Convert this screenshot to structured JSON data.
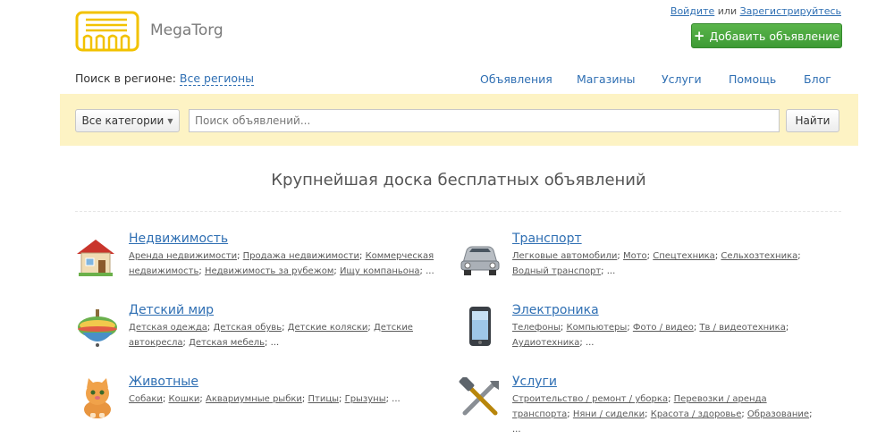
{
  "header": {
    "site_name": "MegaTorg",
    "login": "Войдите",
    "or": " или ",
    "register": "Зарегистрируйтесь",
    "add_button": "Добавить объявление"
  },
  "region": {
    "label": "Поиск в регионе: ",
    "value": "Все регионы"
  },
  "nav": [
    "Объявления",
    "Магазины",
    "Услуги",
    "Помощь",
    "Блог"
  ],
  "search": {
    "categories_label": "Все категории",
    "placeholder": "Поиск объявлений...",
    "button": "Найти"
  },
  "headline": "Крупнейшая доска бесплатных объявлений",
  "categories": [
    {
      "title": "Недвижимость",
      "icon": "house-icon",
      "links": [
        "Аренда недвижимости",
        "Продажа недвижимости",
        "Коммерческая недвижимость",
        "Недвижимость за рубежом",
        "Ищу компаньона"
      ]
    },
    {
      "title": "Транспорт",
      "icon": "car-icon",
      "links": [
        "Легковые автомобили",
        "Мото",
        "Спецтехника",
        "Сельхозтехника",
        "Водный транспорт"
      ]
    },
    {
      "title": "Детский мир",
      "icon": "spinning-top-icon",
      "links": [
        "Детская одежда",
        "Детская обувь",
        "Детские коляски",
        "Детские автокресла",
        "Детская мебель"
      ]
    },
    {
      "title": "Электроника",
      "icon": "smartphone-icon",
      "links": [
        "Телефоны",
        "Компьютеры",
        "Фото / видео",
        "Тв / видеотехника",
        "Аудиотехника"
      ]
    },
    {
      "title": "Животные",
      "icon": "kitten-icon",
      "links": [
        "Собаки",
        "Кошки",
        "Аквариумные рыбки",
        "Птицы",
        "Грызуны"
      ]
    },
    {
      "title": "Услуги",
      "icon": "tools-icon",
      "links": [
        "Строительство / ремонт / уборка",
        "Перевозки / аренда транспорта",
        "Няни / сиделки",
        "Красота / здоровье",
        "Образование"
      ]
    }
  ],
  "separator": "; ",
  "ellipsis": "...",
  "colors": {
    "accent": "#2f6fb3",
    "button_green": "#4caf43",
    "search_band": "#fdf3c4"
  }
}
